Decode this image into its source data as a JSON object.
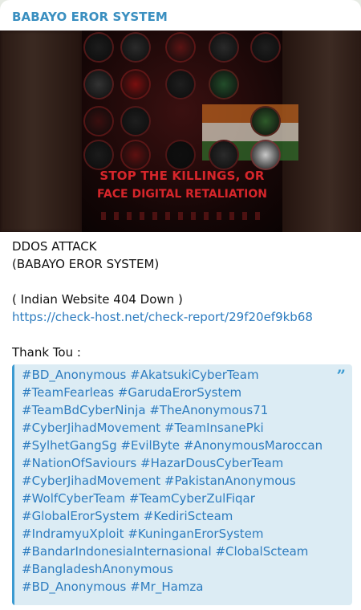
{
  "channel": {
    "name": "BABAYO EROR SYSTEM"
  },
  "poster": {
    "headline_1": "STOP THE KILLINGS, OR",
    "headline_2": "FACE DIGITAL RETALIATION",
    "emblems": [
      {
        "color": "#1c1c1c",
        "icon": "eagle-emblem"
      },
      {
        "color": "#2b2b2b",
        "icon": "skull-emblem"
      },
      {
        "color": "#5b1414",
        "icon": "crest-emblem"
      },
      {
        "color": "#2a2a2a",
        "icon": "wolf-emblem"
      },
      {
        "color": "#1e1e1e",
        "icon": "eagle-emblem"
      },
      {
        "color": "#333",
        "icon": "mask-emblem"
      },
      {
        "color": "#7a0f0f",
        "icon": "skull-emblem"
      },
      {
        "color": "#1e1e1e",
        "icon": "crest-emblem"
      },
      {
        "color": "#234d2a",
        "icon": "flag-emblem"
      },
      {
        "color": "#3a0f0f",
        "icon": "red-circle-emblem"
      },
      {
        "color": "#1e1e1e",
        "icon": "mask-emblem"
      },
      {
        "color": "#2e5a2a",
        "icon": "flag-emblem"
      },
      {
        "color": "#1b1b1b",
        "icon": "anonymous-emblem"
      },
      {
        "color": "#5e1010",
        "icon": "fire-emblem"
      },
      {
        "color": "#0f0f0f",
        "icon": "logo-emblem"
      },
      {
        "color": "#2b2b2b",
        "icon": "anonymous-emblem"
      },
      {
        "color": "#c9c9c9",
        "icon": "anonymous-emblem"
      }
    ]
  },
  "message": {
    "line1": "DDOS ATTACK",
    "line2": "(BABAYO EROR SYSTEM)",
    "line3": "( Indian Website 404 Down )",
    "link": "https://check-host.net/check-report/29f20ef9kb68",
    "thanks": "Thank Tou :"
  },
  "quote": {
    "tag_lines": [
      [
        "#BD_Anonymous",
        "#AkatsukiCyberTeam"
      ],
      [
        "#TeamFearleas",
        "#GarudaErorSystem"
      ],
      [
        "#TeamBdCyberNinja",
        "#TheAnonymous71"
      ],
      [
        "#CyberJihadMovement",
        "#TeamInsanePki"
      ],
      [
        "#SylhetGangSg",
        "#EvilByte",
        "#AnonymousMaroccan"
      ],
      [
        "#NationOfSaviours",
        "#HazarDousCyberTeam"
      ],
      [
        "#CyberJihadMovement",
        "#PakistanAnonymous"
      ],
      [
        "#WolfCyberTeam",
        "#TeamCyberZulFiqar"
      ],
      [
        "#GlobalErorSystem",
        "#KediriScteam"
      ],
      [
        "#IndramyuXploit",
        "#KuninganErorSystem"
      ],
      [
        "#BandarIndonesiaInternasional",
        "#ClobalScteam"
      ],
      [
        "#BangladeshAnonymous"
      ],
      [
        "#BD_Anonymous",
        "#Mr_Hamza"
      ]
    ]
  }
}
